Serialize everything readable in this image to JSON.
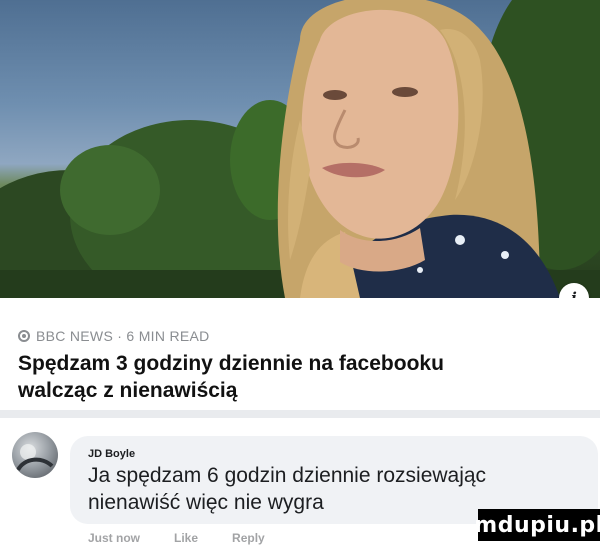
{
  "post": {
    "source": "BBC NEWS · 6 MIN READ",
    "headline_line1": "Spędzam 3 godziny dziennie na facebooku",
    "headline_line2": "walcząc z nienawiścią",
    "info_icon": "info-icon",
    "info_glyph": "i"
  },
  "comment": {
    "author": "JD Boyle",
    "text_line1": "Ja spędzam 6 godzin dziennie rozsiewając",
    "text_line2": "nienawiść więc nie wygra",
    "actions": [
      "Just now",
      "Like",
      "Reply"
    ]
  },
  "watermark": "mdupiu.pl",
  "colors": {
    "card_bg": "#ffffff",
    "bubble_bg": "#f0f2f5",
    "meta_text": "#8a8d91",
    "divider": "#e9ebee"
  }
}
